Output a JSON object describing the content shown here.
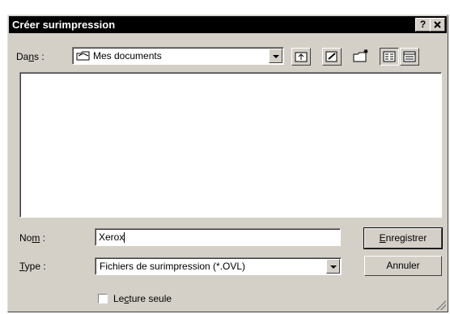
{
  "window": {
    "title": "Créer surimpression",
    "help_button": "?",
    "close_button": "✕"
  },
  "look_in": {
    "label_pre": "Da",
    "label_mnemonic": "n",
    "label_post": "s :",
    "value": "Mes documents"
  },
  "toolbar": {
    "icons": [
      "up-one-level-icon",
      "desktop-icon",
      "new-folder-icon",
      "list-view-icon",
      "details-view-icon"
    ]
  },
  "filename": {
    "label_pre": "No",
    "label_mnemonic": "m",
    "label_post": " :",
    "value": "Xerox"
  },
  "filetype": {
    "label_pre": "",
    "label_mnemonic": "T",
    "label_post": "ype :",
    "value": "Fichiers de surimpression (*.OVL)"
  },
  "readonly": {
    "label_pre": "Le",
    "label_mnemonic": "c",
    "label_post": "ture seule",
    "checked": false
  },
  "buttons": {
    "save_pre": "",
    "save_mnemonic": "E",
    "save_post": "nregistrer",
    "cancel": "Annuler"
  }
}
